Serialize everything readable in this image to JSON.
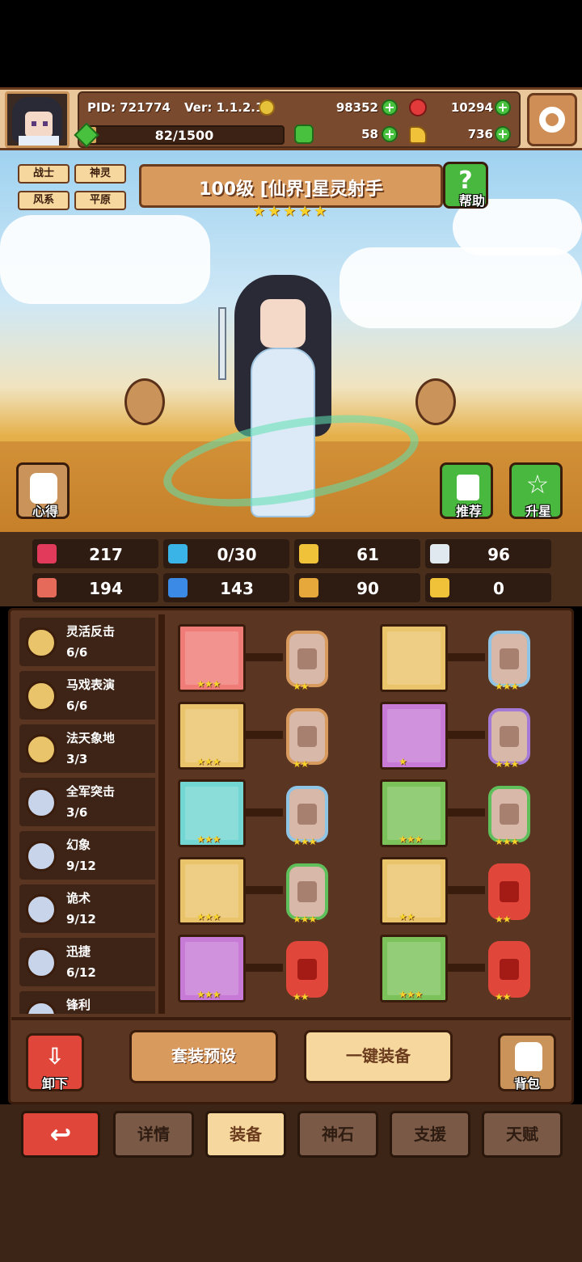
{
  "player": {
    "pid": "PID: 721774",
    "version": "Ver: 1.1.2.1",
    "xp": "82/1500",
    "xp_fraction": 0.055
  },
  "currency": {
    "gold": "98352",
    "gems": "10294",
    "clover": "58",
    "horn": "736"
  },
  "character": {
    "tags": [
      "战士",
      "神灵",
      "风系",
      "平原"
    ],
    "title": "100级 [仙界]星灵射手",
    "stars": 5,
    "help_label": "帮助",
    "insight_label": "心得",
    "recommend_label": "推荐",
    "upgrade_label": "升星"
  },
  "stats": [
    {
      "icon": "heart-icon",
      "value": "217"
    },
    {
      "icon": "water-drop-icon",
      "value": "0/30"
    },
    {
      "icon": "shield-icon",
      "value": "61"
    },
    {
      "icon": "wing-icon",
      "value": "96"
    },
    {
      "icon": "fist-icon",
      "value": "194"
    },
    {
      "icon": "book-icon",
      "value": "143"
    },
    {
      "icon": "boot-icon",
      "value": "90"
    },
    {
      "icon": "horseshoe-icon",
      "value": "0"
    }
  ],
  "sets": [
    {
      "name": "灵活反击",
      "count": "6/6",
      "color": "gold"
    },
    {
      "name": "马戏表演",
      "count": "6/6",
      "color": "gold"
    },
    {
      "name": "法天象地",
      "count": "3/3",
      "color": "gold"
    },
    {
      "name": "全军突击",
      "count": "3/6",
      "color": "silver"
    },
    {
      "name": "幻象",
      "count": "9/12",
      "color": "silver"
    },
    {
      "name": "诡术",
      "count": "9/12",
      "color": "silver"
    },
    {
      "name": "迅捷",
      "count": "6/12",
      "color": "silver"
    },
    {
      "name": "锋利",
      "count": "",
      "color": "silver"
    }
  ],
  "equipment": [
    {
      "item": "staff-icon",
      "bg": "red",
      "stars": "★★★",
      "slot_color": "orange",
      "slot_stars": "★★"
    },
    {
      "item": "helmet-icon",
      "bg": "gold",
      "stars": "",
      "slot_color": "blue",
      "slot_stars": "★★★"
    },
    {
      "item": "crossed-swords-icon",
      "bg": "gold",
      "stars": "★★★",
      "slot_color": "orange",
      "slot_stars": "★★"
    },
    {
      "item": "armor-icon",
      "bg": "purple",
      "stars": "★",
      "slot_color": "purple",
      "slot_stars": "★★★"
    },
    {
      "item": "necklace-icon",
      "bg": "teal",
      "stars": "★★★",
      "slot_color": "blue",
      "slot_stars": "★★★"
    },
    {
      "item": "bracer-icon",
      "bg": "green",
      "stars": "★★★",
      "slot_color": "green",
      "slot_stars": "★★★"
    },
    {
      "item": "amulet-icon",
      "bg": "gold",
      "stars": "★★★",
      "slot_color": "green",
      "slot_stars": "★★★"
    },
    {
      "item": "belt-icon",
      "bg": "gold",
      "stars": "★★",
      "slot_color": "red",
      "slot_stars": "★★"
    },
    {
      "item": "ring-icon",
      "bg": "purple",
      "stars": "★★★",
      "slot_color": "red",
      "slot_stars": "★★"
    },
    {
      "item": "boots-icon",
      "bg": "green",
      "stars": "★★★",
      "slot_color": "red",
      "slot_stars": "★★"
    }
  ],
  "actions": {
    "unequip": "卸下",
    "preset": "套装预设",
    "auto_equip": "一键装备",
    "bag": "背包"
  },
  "tabs": [
    "详情",
    "装备",
    "神石",
    "支援",
    "天赋"
  ],
  "active_tab": "装备",
  "colors": {
    "red": "#f07c78",
    "gold": "#e9c46a",
    "purple": "#c77ad6",
    "teal": "#72d6d2",
    "green": "#7cc25a",
    "orange": "#d99a5e",
    "blue": "#8ec4e6",
    "slot_green": "#5fbf5a",
    "slot_purple": "#a47ad6",
    "slot_red": "#e0463a"
  }
}
